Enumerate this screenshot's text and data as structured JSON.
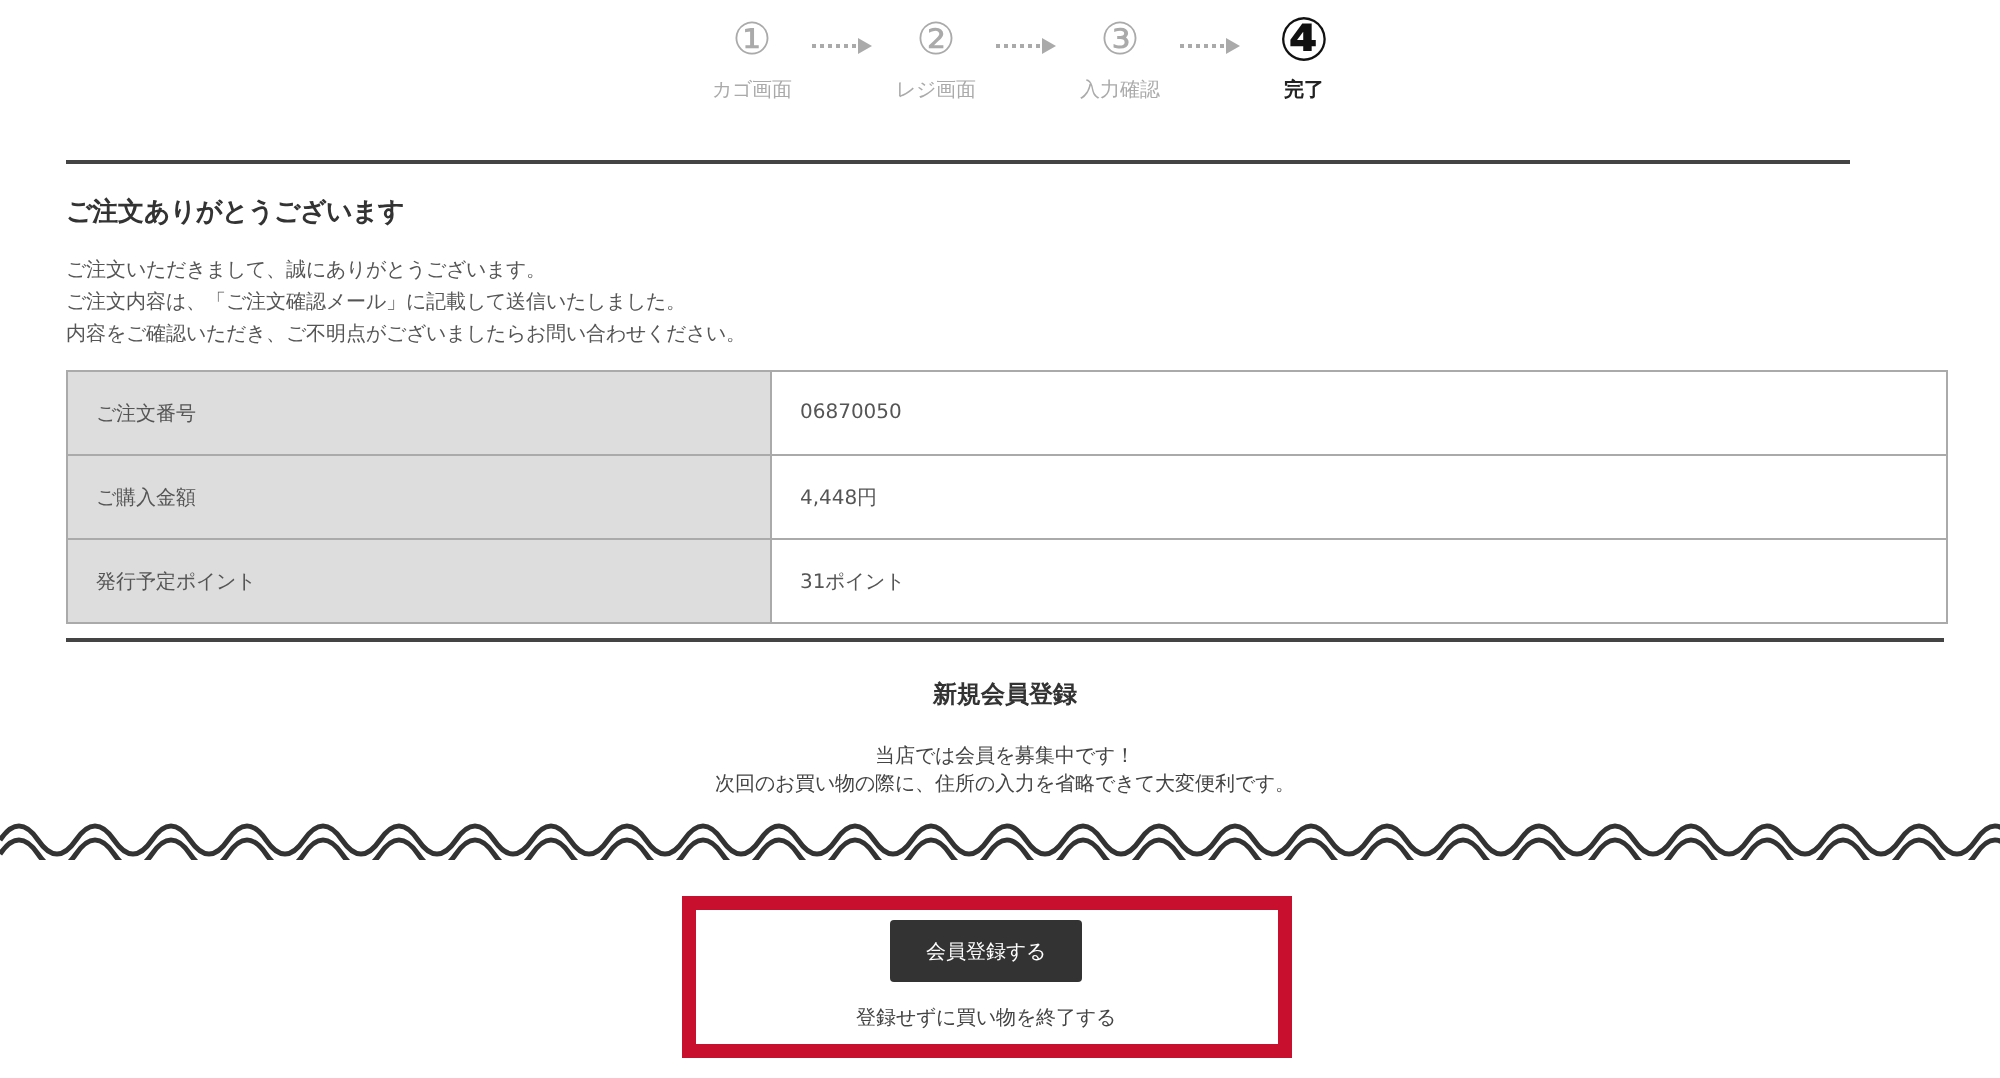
{
  "steps": [
    {
      "number": "①",
      "label": "カゴ画面",
      "selected": false
    },
    {
      "number": "②",
      "label": "レジ画面",
      "selected": false
    },
    {
      "number": "③",
      "label": "入力確認",
      "selected": false
    },
    {
      "number": "④",
      "label": "完了",
      "selected": true
    }
  ],
  "heading": "ご注文ありがとうございます",
  "message": [
    "ご注文いただきまして、誠にありがとうございます。",
    "ご注文内容は、「ご注文確認メール」に記載して送信いたしました。",
    "内容をご確認いただき、ご不明点がございましたらお問い合わせください。"
  ],
  "order_table": [
    {
      "label": "ご注文番号",
      "value": "06870050"
    },
    {
      "label": "ご購入金額",
      "value": "4,448円"
    },
    {
      "label": "発行予定ポイント",
      "value": "31ポイント"
    }
  ],
  "registration": {
    "title": "新規会員登録",
    "lines": [
      "当店では会員を募集中です！",
      "次回のお買い物の際に、住所の入力を省略できて大変便利です。"
    ],
    "button": "会員登録する",
    "link": "登録せずに買い物を終了する"
  }
}
